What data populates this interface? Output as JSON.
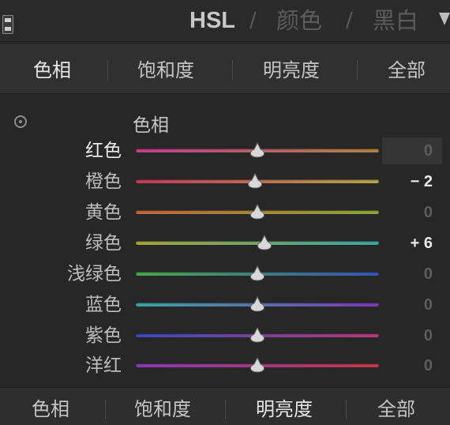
{
  "header": {
    "title_hsl": "HSL",
    "sep1": "/",
    "title_color": "颜色",
    "sep2": "/",
    "title_bw": "黑白"
  },
  "tabs_top": [
    {
      "label": "色相",
      "active": true
    },
    {
      "label": "饱和度",
      "active": false
    },
    {
      "label": "明亮度",
      "active": false
    },
    {
      "label": "全部",
      "active": false
    }
  ],
  "section": {
    "title": "色相"
  },
  "sliders": [
    {
      "label": "红色",
      "value": "0",
      "numeric": 0,
      "colors": [
        "#c13d8d",
        "#b08242"
      ],
      "highlighted": true
    },
    {
      "label": "橙色",
      "value": "− 2",
      "numeric": -2,
      "colors": [
        "#c23a5a",
        "#b0a44a"
      ],
      "highlighted": false
    },
    {
      "label": "黄色",
      "value": "0",
      "numeric": 0,
      "colors": [
        "#c0663c",
        "#8aa63c"
      ],
      "highlighted": false
    },
    {
      "label": "绿色",
      "value": "+ 6",
      "numeric": 6,
      "colors": [
        "#a4a63a",
        "#3ca6a4"
      ],
      "highlighted": false
    },
    {
      "label": "浅绿色",
      "value": "0",
      "numeric": 0,
      "colors": [
        "#4aa64a",
        "#3a56b4"
      ],
      "highlighted": false
    },
    {
      "label": "蓝色",
      "value": "0",
      "numeric": 0,
      "colors": [
        "#3aa6a2",
        "#7a3ab4"
      ],
      "highlighted": false
    },
    {
      "label": "紫色",
      "value": "0",
      "numeric": 0,
      "colors": [
        "#3a4cb6",
        "#b43a7a"
      ],
      "highlighted": false
    },
    {
      "label": "洋红",
      "value": "0",
      "numeric": 0,
      "colors": [
        "#8a3ab6",
        "#c03a4a"
      ],
      "highlighted": false
    }
  ],
  "tabs_bottom": [
    {
      "label": "色相",
      "active": false
    },
    {
      "label": "饱和度",
      "active": false
    },
    {
      "label": "明亮度",
      "active": true
    },
    {
      "label": "全部",
      "active": false
    }
  ]
}
